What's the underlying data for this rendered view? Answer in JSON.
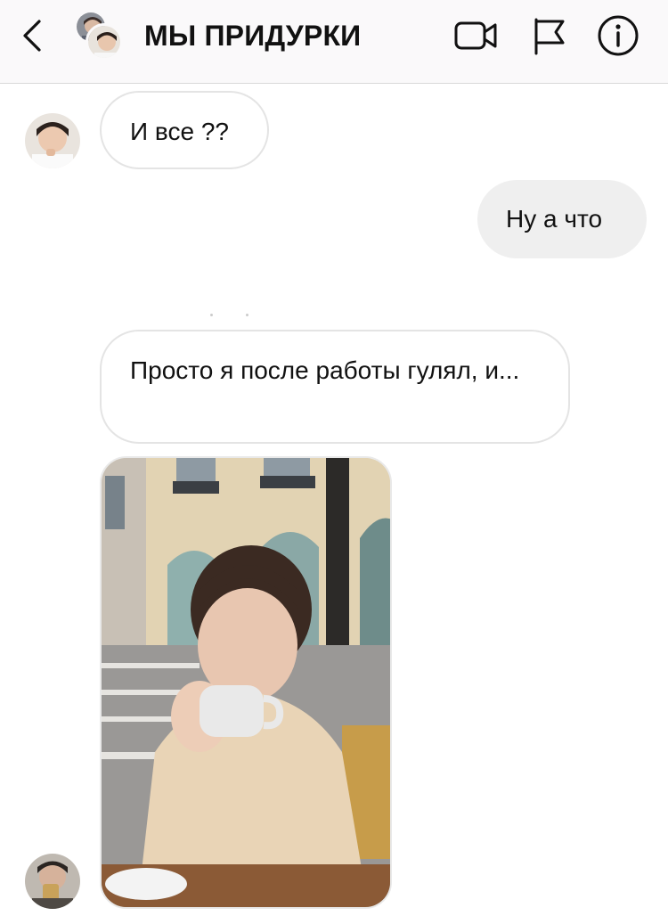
{
  "header": {
    "title": "МЫ ПРИДУРКИ",
    "icons": [
      "back-chevron-icon",
      "video-camera-icon",
      "flag-icon",
      "info-icon"
    ]
  },
  "messages": [
    {
      "direction": "incoming",
      "text": "И все ??"
    },
    {
      "direction": "outgoing",
      "text": "Ну а что"
    },
    {
      "direction": "incoming",
      "text": "Просто я после работы гулял, и..."
    },
    {
      "direction": "incoming",
      "type": "photo"
    }
  ],
  "colors": {
    "header_bg": "#faf9fa",
    "incoming_border": "#e4e4e4",
    "outgoing_bg": "#efefef",
    "text": "#111111"
  }
}
